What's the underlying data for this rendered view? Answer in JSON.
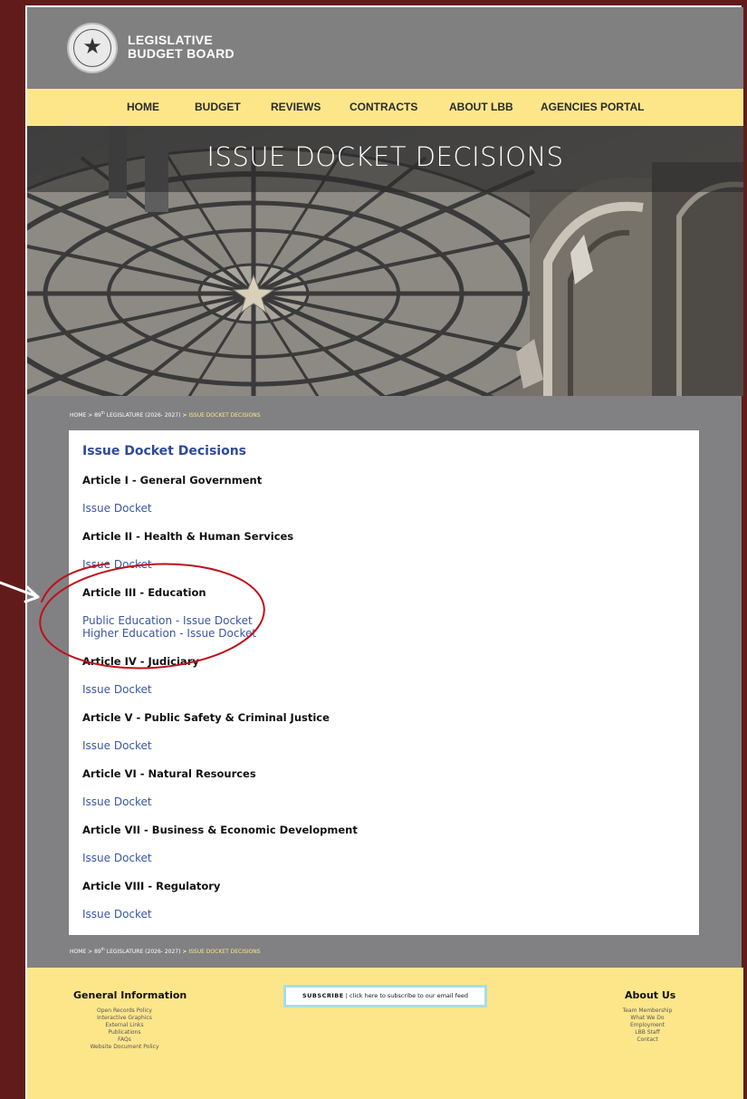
{
  "header": {
    "logo_line1": "LEGISLATIVE",
    "logo_line2": "BUDGET BOARD",
    "seal_icon": "texas-state-seal-icon"
  },
  "nav": {
    "items": [
      "HOME",
      "BUDGET",
      "REVIEWS",
      "CONTRACTS",
      "ABOUT LBB",
      "AGENCIES PORTAL"
    ]
  },
  "hero": {
    "title": "ISSUE DOCKET DECISIONS"
  },
  "breadcrumb": {
    "home": "HOME",
    "sep": ">",
    "leg_num": "89",
    "leg_sup": "th",
    "leg_rest": "LEGISLATURE (2026- 2027)",
    "current": "ISSUE DOCKET DECISIONS"
  },
  "content": {
    "title": "Issue Docket Decisions",
    "articles": [
      {
        "heading": "Article I - General Government",
        "links": [
          "Issue Docket"
        ]
      },
      {
        "heading": "Article II - Health & Human Services",
        "links": [
          "Issue Docket"
        ]
      },
      {
        "heading": "Article III - Education",
        "links": [
          "Public Education - Issue Docket",
          "Higher Education - Issue Docket"
        ]
      },
      {
        "heading": "Article IV - Judiciary",
        "links": [
          "Issue Docket"
        ]
      },
      {
        "heading": "Article V - Public Safety & Criminal Justice",
        "links": [
          "Issue Docket"
        ]
      },
      {
        "heading": "Article VI - Natural Resources",
        "links": [
          "Issue Docket"
        ]
      },
      {
        "heading": "Article VII - Business & Economic Development",
        "links": [
          "Issue Docket"
        ]
      },
      {
        "heading": "Article VIII - Regulatory",
        "links": [
          "Issue Docket"
        ]
      }
    ]
  },
  "footer": {
    "general_heading": "General Information",
    "general_links": [
      "Open Records Policy",
      "Interactive Graphics",
      "External Links",
      "Publications",
      "FAQs",
      "Website Document Policy"
    ],
    "subscribe_label": "SUBSCRIBE",
    "subscribe_sep": "|",
    "subscribe_text": "click here to subscribe to our email feed",
    "about_heading": "About Us",
    "about_links": [
      "Team Membership",
      "What We Do",
      "Employment",
      "LBB Staff",
      "Contact"
    ]
  },
  "colors": {
    "background": "#621b1b",
    "nav": "#fde68a",
    "link": "#3a56a6",
    "annotation": "#c0101a"
  }
}
